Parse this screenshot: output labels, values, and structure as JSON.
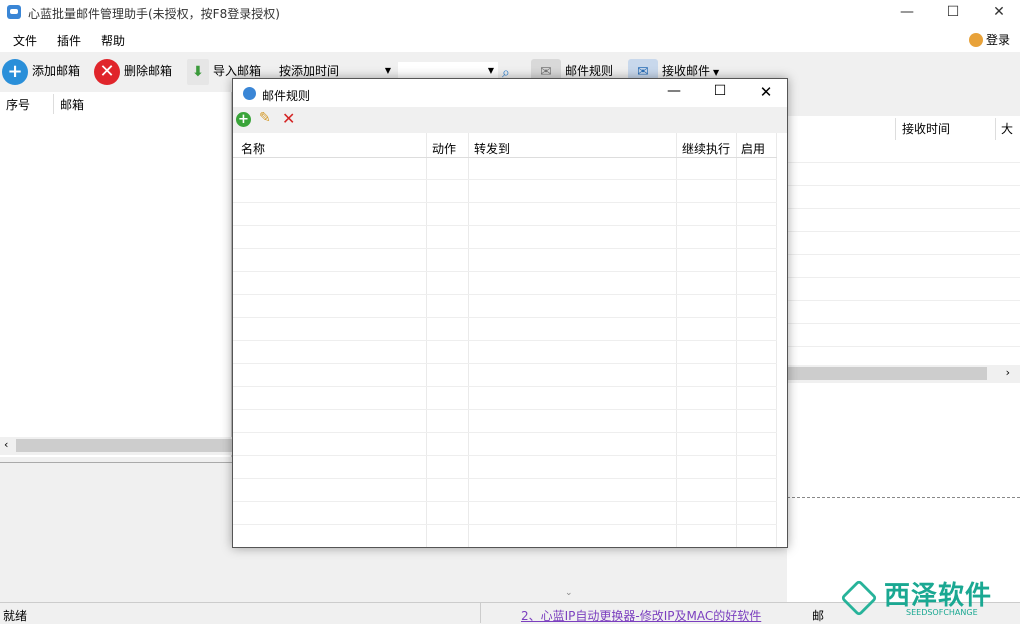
{
  "app": {
    "title": "心蓝批量邮件管理助手(未授权，按F8登录授权)"
  },
  "menu": {
    "items": [
      "文件",
      "插件",
      "帮助"
    ],
    "login": "登录"
  },
  "toolbar": {
    "add": "添加邮箱",
    "delete": "删除邮箱",
    "import": "导入邮箱",
    "sort": "按添加时间",
    "rules": "邮件规则",
    "receive": "接收邮件"
  },
  "left_table": {
    "columns": [
      "序号",
      "邮箱"
    ]
  },
  "right_table": {
    "columns": [
      "接收时间",
      "大"
    ]
  },
  "dialog": {
    "title": "邮件规则",
    "columns": [
      "名称",
      "动作",
      "转发到",
      "继续执行",
      "启用"
    ]
  },
  "status": {
    "left": "就绪",
    "link": "2、心蓝IP自动更换器-修改IP及MAC的好软件",
    "right": "邮"
  },
  "watermark": {
    "text": "西泽软件",
    "sub": "SEEDSOFCHANGE"
  }
}
